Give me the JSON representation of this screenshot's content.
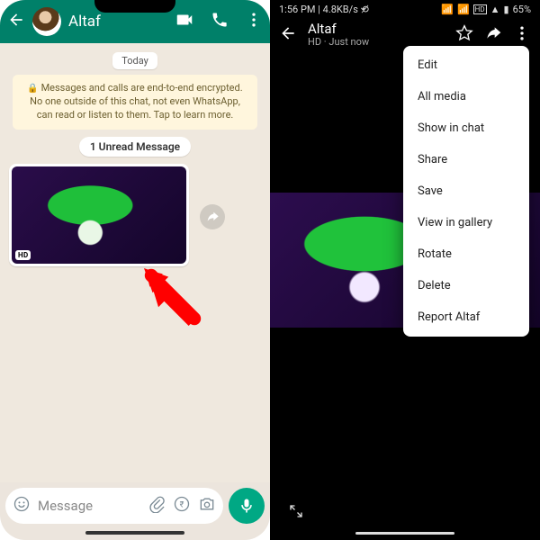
{
  "left": {
    "contact_name": "Altaf",
    "date_label": "Today",
    "encryption_notice": "Messages and calls are end-to-end encrypted. No one outside of this chat, not even WhatsApp, can read or listen to them. Tap to learn more.",
    "unread_label": "1 Unread Message",
    "hd_badge": "HD",
    "input_placeholder": "Message"
  },
  "right": {
    "status_time": "1:56 PM",
    "status_net": "4.8KB/s",
    "status_batt": "65%",
    "title": "Altaf",
    "subtitle": "HD · Just now",
    "menu": [
      "Edit",
      "All media",
      "Show in chat",
      "Share",
      "Save",
      "View in gallery",
      "Rotate",
      "Delete",
      "Report Altaf"
    ]
  }
}
